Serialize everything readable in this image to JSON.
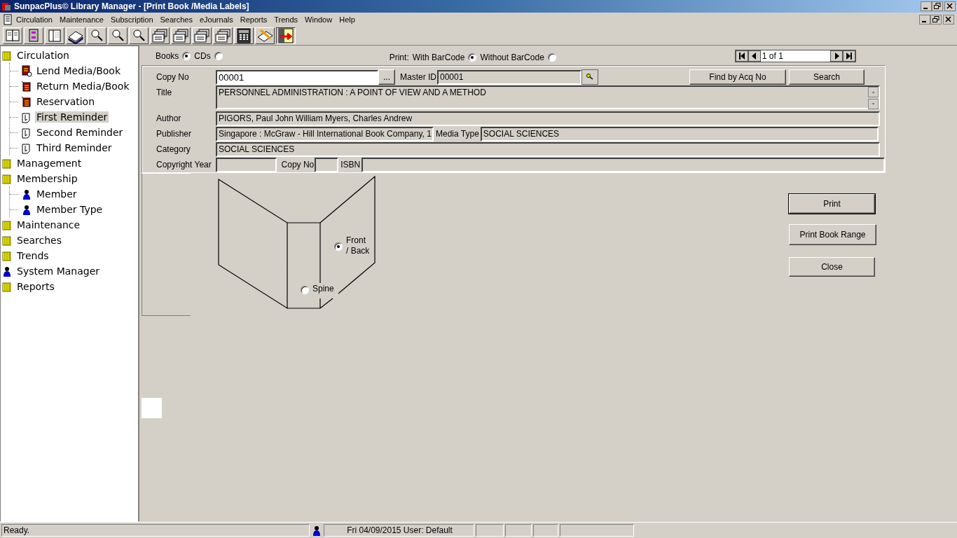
{
  "window": {
    "title": "SunpacPlus© Library Manager - [Print Book /Media Labels]"
  },
  "menu": [
    "Circulation",
    "Maintenance",
    "Subscription",
    "Searches",
    "eJournals",
    "Reports",
    "Trends",
    "Window",
    "Help"
  ],
  "sidebar": {
    "items": [
      {
        "label": "Circulation",
        "kind": "folder",
        "selected": false,
        "children": [
          {
            "label": "Lend Media/Book",
            "kind": "lend",
            "selected": false
          },
          {
            "label": "Return Media/Book",
            "kind": "book",
            "selected": false
          },
          {
            "label": "Reservation",
            "kind": "book",
            "selected": false
          },
          {
            "label": "First Reminder",
            "kind": "reminder",
            "selected": true
          },
          {
            "label": "Second Reminder",
            "kind": "reminder",
            "selected": false
          },
          {
            "label": "Third Reminder",
            "kind": "reminder",
            "selected": false
          }
        ]
      },
      {
        "label": "Management",
        "kind": "folder",
        "selected": false
      },
      {
        "label": "Membership",
        "kind": "folder",
        "selected": false,
        "children": [
          {
            "label": "Member",
            "kind": "person",
            "selected": false
          },
          {
            "label": "Member Type",
            "kind": "person",
            "selected": false
          }
        ]
      },
      {
        "label": "Maintenance",
        "kind": "folder",
        "selected": false
      },
      {
        "label": "Searches",
        "kind": "folder",
        "selected": false
      },
      {
        "label": "Trends",
        "kind": "folder",
        "selected": false
      },
      {
        "label": "System Manager",
        "kind": "person",
        "selected": false
      },
      {
        "label": "Reports",
        "kind": "folder",
        "selected": false
      }
    ]
  },
  "media_type": [
    {
      "label": "Books",
      "selected": true
    },
    {
      "label": "CDs",
      "selected": false
    }
  ],
  "print_option": {
    "label": "Print:",
    "options": [
      {
        "label": "With BarCode",
        "selected": true
      },
      {
        "label": "Without BarCode",
        "selected": false
      }
    ]
  },
  "pager": {
    "text": "1 of 1"
  },
  "form": {
    "copy_no": {
      "label": "Copy No",
      "value": "00001",
      "button": "..."
    },
    "master_id": {
      "label": "Master ID",
      "value": "00001"
    },
    "find_button": "Find by Acq No",
    "search_button": "Search",
    "title": {
      "label": "Title",
      "value": "PERSONNEL ADMINISTRATION : A POINT OF VIEW AND A METHOD"
    },
    "author": {
      "label": "Author",
      "value": "PIGORS, Paul John William  Myers, Charles Andrew"
    },
    "publisher": {
      "label": "Publisher",
      "value": "Singapore : McGraw - Hill International Book Company, 1"
    },
    "media_type": {
      "label": "Media Type",
      "value": "SOCIAL SCIENCES"
    },
    "category": {
      "label": "Category",
      "value": "SOCIAL SCIENCES"
    },
    "copyright_year": {
      "label": "Copyright Year"
    },
    "copy_no_2": {
      "label": "Copy No"
    },
    "isbn": {
      "label": "ISBN"
    }
  },
  "label_side": [
    {
      "label": "Front / Back",
      "selected": true
    },
    {
      "label": "Spine",
      "selected": false
    }
  ],
  "buttons": [
    "Print",
    "Print Book Range",
    "Close"
  ],
  "status_bar": {
    "message": "Ready.",
    "date_user": "Fri 04/09/2015 User: Default"
  }
}
